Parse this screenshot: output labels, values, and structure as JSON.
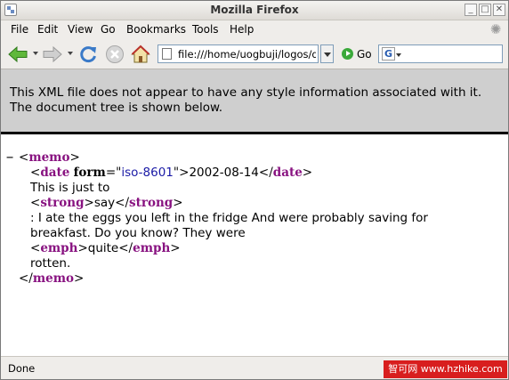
{
  "window": {
    "title": "Mozilla Firefox"
  },
  "menubar": {
    "items": [
      "File",
      "Edit",
      "View",
      "Go",
      "Bookmarks",
      "Tools",
      "Help"
    ]
  },
  "toolbar": {
    "url": "file:///home/uogbuji/logos/dv",
    "go_label": "Go",
    "icons": [
      "back-icon",
      "forward-icon",
      "reload-icon",
      "stop-icon",
      "home-icon"
    ]
  },
  "content": {
    "notice": "This XML file does not appear to have any style information associated with it. The document tree is shown below.",
    "collapse_marker": "−",
    "xml": {
      "root_tag": "memo",
      "date_tag": "date",
      "date_attr_name": "form",
      "date_attr_value": "iso-8601",
      "date_text": "2002-08-14",
      "text1": "This is just to",
      "strong_tag": "strong",
      "strong_text": "say",
      "text2_line1": ": I ate the eggs you left in the fridge And were probably saving for",
      "text2_line2": "breakfast. Do you know? They were",
      "emph_tag": "emph",
      "emph_text": "quite",
      "text3": "rotten."
    }
  },
  "status": {
    "text": "Done"
  },
  "watermark": {
    "text": "智可网 www.hzhike.com"
  },
  "colors": {
    "tag": "#881280",
    "attr_value": "#1a1aa6",
    "notice_bg": "#cfcfcf"
  }
}
